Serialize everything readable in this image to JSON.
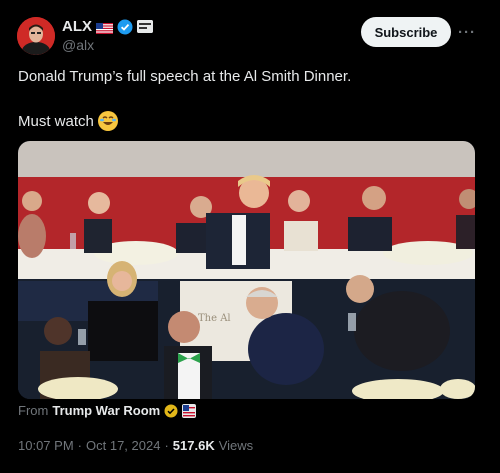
{
  "author": {
    "display_name": "ALX",
    "handle": "@alx",
    "avatar_icon": "avatar-portrait",
    "flag_icon": "us-flag-icon",
    "verified_icon": "verified-badge-icon",
    "affiliation_icon": "affiliation-badge-icon"
  },
  "actions": {
    "subscribe_label": "Subscribe",
    "more_label": "···"
  },
  "post": {
    "line1": "Donald Trump’s full speech at the Al Smith Dinner.",
    "line2": "Must watch",
    "emoji_icon": "rolling-laughing-emoji"
  },
  "media": {
    "type": "video",
    "podium_text": "The Al"
  },
  "source": {
    "prefix": "From",
    "name": "Trump War Room"
  },
  "meta": {
    "time": "10:07 PM",
    "separator": "·",
    "date": "Oct 17, 2024",
    "separator2": "·",
    "views_count": "517.6K",
    "views_label": "Views"
  },
  "colors": {
    "background": "#000000",
    "text": "#e7e9ea",
    "muted": "#71767b",
    "verified_blue": "#1d9bf0",
    "gold_badge": "#e2b719"
  }
}
